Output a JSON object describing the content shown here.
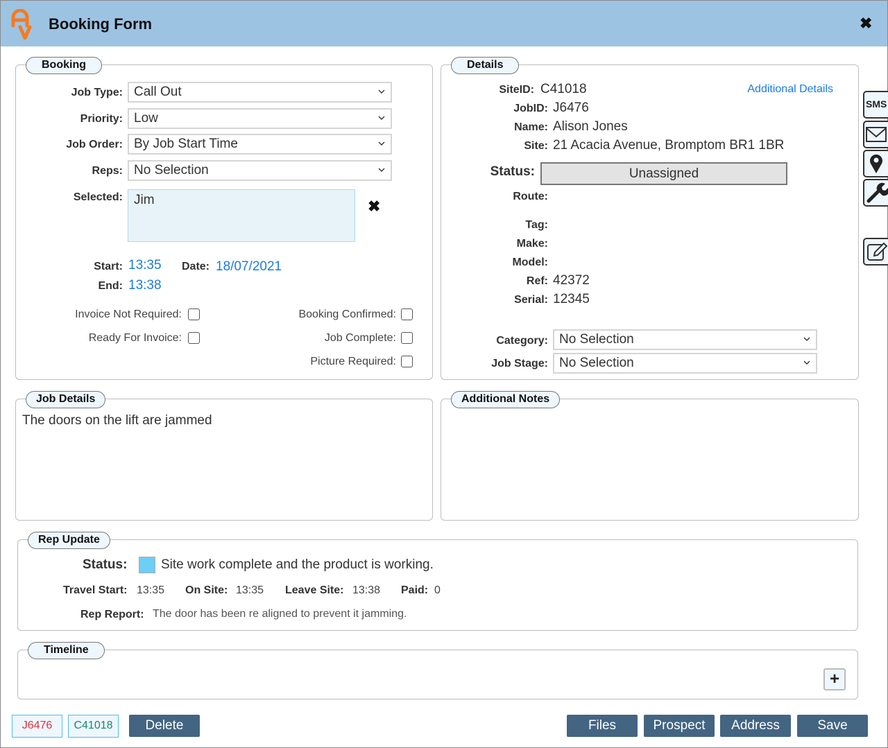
{
  "window": {
    "title": "Booking Form",
    "close_icon": "close-icon"
  },
  "side_toolbar": [
    {
      "name": "sms",
      "label": "SMS"
    },
    {
      "name": "email",
      "icon": "envelope-icon"
    },
    {
      "name": "location",
      "icon": "map-pin-icon"
    },
    {
      "name": "tools",
      "icon": "wrench-icon"
    },
    {
      "name": "edit",
      "icon": "edit-icon"
    }
  ],
  "booking": {
    "legend": "Booking",
    "job_type": {
      "label": "Job Type:",
      "value": "Call Out"
    },
    "priority": {
      "label": "Priority:",
      "value": "Low"
    },
    "job_order": {
      "label": "Job Order:",
      "value": "By Job Start Time"
    },
    "reps": {
      "label": "Reps:",
      "value": "No Selection"
    },
    "selected": {
      "label": "Selected:",
      "value": "Jim"
    },
    "start": {
      "label": "Start:",
      "value": "13:35"
    },
    "date": {
      "label": "Date:",
      "value": "18/07/2021"
    },
    "end": {
      "label": "End:",
      "value": "13:38"
    },
    "checkboxes": {
      "invoice_not_required": {
        "label": "Invoice Not Required:",
        "checked": false
      },
      "ready_for_invoice": {
        "label": "Ready For Invoice:",
        "checked": false
      },
      "booking_confirmed": {
        "label": "Booking Confirmed:",
        "checked": false
      },
      "job_complete": {
        "label": "Job Complete:",
        "checked": false
      },
      "picture_required": {
        "label": "Picture Required:",
        "checked": false
      }
    }
  },
  "details": {
    "legend": "Details",
    "additional_details_link": "Additional Details",
    "site_id": {
      "label": "SiteID:",
      "value": "C41018"
    },
    "job_id": {
      "label": "JobID:",
      "value": "J6476"
    },
    "name": {
      "label": "Name:",
      "value": "Alison Jones"
    },
    "site": {
      "label": "Site:",
      "value": "21 Acacia Avenue, Bromptom BR1 1BR"
    },
    "status": {
      "label": "Status:",
      "value": "Unassigned"
    },
    "route": {
      "label": "Route:",
      "value": ""
    },
    "tag": {
      "label": "Tag:",
      "value": ""
    },
    "make": {
      "label": "Make:",
      "value": ""
    },
    "model": {
      "label": "Model:",
      "value": ""
    },
    "ref": {
      "label": "Ref:",
      "value": "42372"
    },
    "serial": {
      "label": "Serial:",
      "value": "12345"
    },
    "category": {
      "label": "Category:",
      "value": "No Selection"
    },
    "job_stage": {
      "label": "Job Stage:",
      "value": "No Selection"
    }
  },
  "job_details": {
    "legend": "Job Details",
    "text": "The doors on the lift are jammed"
  },
  "additional_notes": {
    "legend": "Additional Notes",
    "text": ""
  },
  "rep_update": {
    "legend": "Rep Update",
    "status_label": "Status:",
    "status_color": "#6ccff6",
    "status_text": "Site work complete and the product is working.",
    "travel_start": {
      "label": "Travel Start:",
      "value": "13:35"
    },
    "on_site": {
      "label": "On Site:",
      "value": "13:35"
    },
    "leave_site": {
      "label": "Leave Site:",
      "value": "13:38"
    },
    "paid": {
      "label": "Paid:",
      "value": "0"
    },
    "rep_report": {
      "label": "Rep Report:",
      "value": "The door has been re aligned to prevent it jamming."
    }
  },
  "timeline": {
    "legend": "Timeline",
    "add_icon": "plus-icon"
  },
  "footer": {
    "job_tag": "J6476",
    "site_tag": "C41018",
    "delete": "Delete",
    "files": "Files",
    "prospect": "Prospect",
    "address": "Address",
    "save": "Save"
  },
  "colors": {
    "titlebar": "#9dc3e3",
    "button": "#436582",
    "link": "#1a7be6",
    "logo": "#f47b20",
    "job_tag": "#e8303a",
    "site_tag": "#138a6e"
  }
}
